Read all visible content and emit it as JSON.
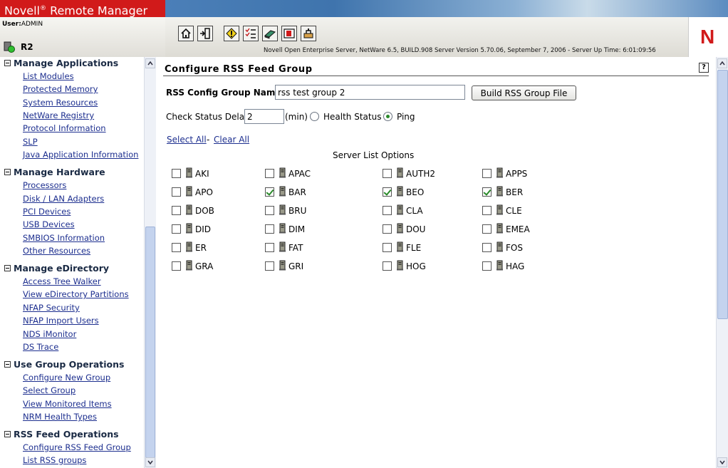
{
  "header": {
    "product_name": "Novell",
    "product_mark": "®",
    "product_suffix": "Remote Manager",
    "user_label": "User:",
    "user_name": "ADMIN",
    "server_name": "R2",
    "status_line": "Novell Open Enterprise Server, NetWare 6.5, BUILD.908  Server Version 5.70.06, September 7, 2006 - Server Up Time: 6:01:09:56",
    "logo_letter": "N",
    "toolbar_icons": [
      "home-icon",
      "exit-icon",
      "health-warning-icon",
      "task-list-icon",
      "volumes-icon",
      "console-icon",
      "utilities-icon"
    ]
  },
  "sidebar": {
    "sections": [
      {
        "title": "Manage Applications",
        "items": [
          "List Modules",
          "Protected Memory",
          "System Resources",
          "NetWare Registry",
          "Protocol Information",
          "SLP",
          "Java Application Information"
        ]
      },
      {
        "title": "Manage Hardware",
        "items": [
          "Processors",
          "Disk / LAN Adapters",
          "PCI Devices",
          "USB Devices",
          "SMBIOS Information",
          "Other Resources"
        ]
      },
      {
        "title": "Manage eDirectory",
        "items": [
          "Access Tree Walker",
          "View eDirectory Partitions",
          "NFAP Security",
          "NFAP Import Users",
          "NDS iMonitor",
          "DS Trace"
        ]
      },
      {
        "title": "Use Group Operations",
        "items": [
          "Configure New Group",
          "Select Group",
          "View Monitored Items",
          "NRM Health Types"
        ]
      },
      {
        "title": "RSS Feed Operations",
        "items": [
          "Configure RSS Feed Group",
          "List RSS groups"
        ]
      }
    ]
  },
  "main": {
    "title": "Configure RSS Feed Group",
    "help": "?",
    "name_label": "RSS Config Group Name:",
    "name_value": "rss test group 2",
    "build_button": "Build RSS Group File",
    "delay_label": "Check Status Delay",
    "delay_value": "2",
    "delay_unit": "(min)",
    "radio_health": "Health Status",
    "radio_ping": "Ping",
    "selected_radio": "Ping",
    "select_all": "Select All",
    "separator": "-",
    "clear_all": "Clear All",
    "options_label": "Server List Options",
    "servers": [
      {
        "name": "AKI",
        "checked": false
      },
      {
        "name": "APAC",
        "checked": false
      },
      {
        "name": "AUTH2",
        "checked": false
      },
      {
        "name": "APPS",
        "checked": false
      },
      {
        "name": "APO",
        "checked": false
      },
      {
        "name": "BAR",
        "checked": true
      },
      {
        "name": "BEO",
        "checked": true
      },
      {
        "name": "BER",
        "checked": true
      },
      {
        "name": "DOB",
        "checked": false
      },
      {
        "name": "BRU",
        "checked": false
      },
      {
        "name": "CLA",
        "checked": false
      },
      {
        "name": "CLE",
        "checked": false
      },
      {
        "name": "DID",
        "checked": false
      },
      {
        "name": "DIM",
        "checked": false
      },
      {
        "name": "DOU",
        "checked": false
      },
      {
        "name": "EMEA",
        "checked": false
      },
      {
        "name": "ER",
        "checked": false
      },
      {
        "name": "FAT",
        "checked": false
      },
      {
        "name": "FLE",
        "checked": false
      },
      {
        "name": "FOS",
        "checked": false
      },
      {
        "name": "GRA",
        "checked": false
      },
      {
        "name": "GRI",
        "checked": false
      },
      {
        "name": "HOG",
        "checked": false
      },
      {
        "name": "HAG",
        "checked": false
      }
    ]
  },
  "colors": {
    "brand_red": "#d11a1a",
    "link": "#1d2f8f",
    "check_green": "#2a8a2a",
    "banner_blue": "#4b7fb8"
  }
}
